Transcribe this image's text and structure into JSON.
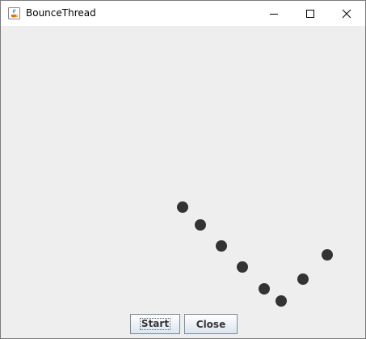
{
  "window": {
    "title": "BounceThread",
    "app_icon": "java-cup-icon",
    "controls": {
      "minimize_icon": "minimize-icon",
      "maximize_icon": "maximize-icon",
      "close_icon": "close-icon"
    }
  },
  "canvas": {
    "background": "#eeeeee",
    "ball_color": "#333333",
    "ball_count": 8
  },
  "buttons": {
    "start_label": "Start",
    "close_label": "Close"
  }
}
